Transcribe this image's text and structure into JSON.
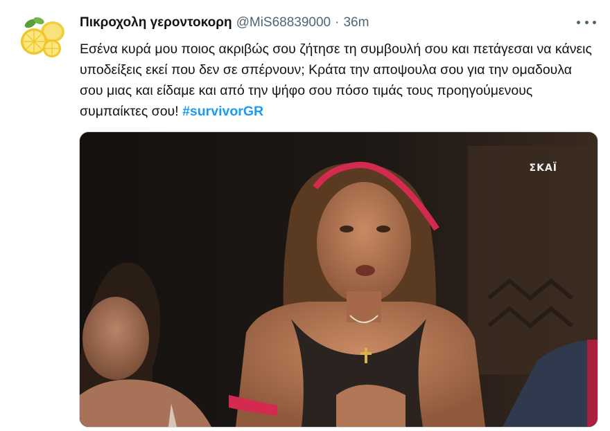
{
  "tweet": {
    "display_name": "Πικροχολη γεροντοκορη",
    "handle": "@MiS68839000",
    "separator": "·",
    "time": "36m",
    "text_body": "Εσένα κυρά μου ποιος ακριβώς σου ζήτησε τη συμβουλή σου και πετάγεσαι να κάνεις υποδείξεις εκεί που δεν σε σπέρνουν; Κράτα την αποψουλα σου για την ομαδουλα σου μιας και είδαμε και από την ψήφο σου πόσο τιμάς τους προηγούμενους συμπαίκτες σου! ",
    "hashtag": "#survivorGR"
  },
  "media": {
    "watermark": "ΣΚΑΪ"
  },
  "icons": {
    "avatar": "lemon-avatar-icon",
    "more": "more-options-icon"
  },
  "colors": {
    "link": "#1d9bf0",
    "text": "#0f1419",
    "secondary": "#536471"
  }
}
